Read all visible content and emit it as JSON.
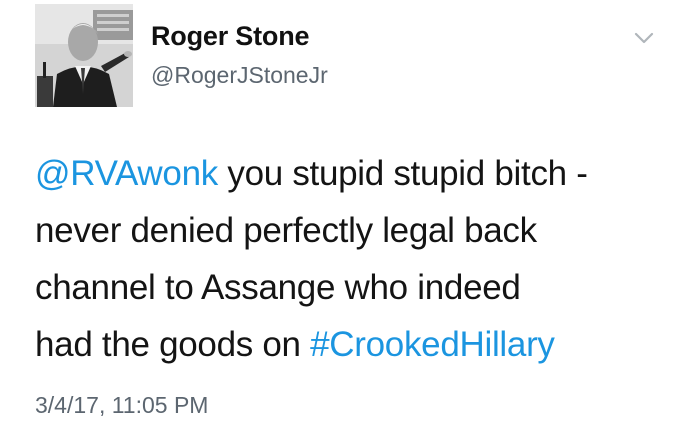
{
  "author": {
    "name": "Roger Stone",
    "handle": "@RogerJStoneJr",
    "avatar_alt": "profile-photo"
  },
  "tweet": {
    "line1": {
      "mention": "@RVAwonk",
      "text": " you stupid stupid bitch -"
    },
    "line2": "never denied perfectly legal back",
    "line3": "channel to Assange who indeed",
    "line4": {
      "text": "had the goods on ",
      "hashtag": "#CrookedHillary"
    }
  },
  "meta": {
    "timestamp": "3/4/17, 11:05 PM"
  },
  "icons": {
    "menu": "chevron-down-icon"
  },
  "colors": {
    "link": "#1b95e0",
    "text": "#141414",
    "secondary": "#5c6670",
    "chevron": "#b0b6bb"
  }
}
